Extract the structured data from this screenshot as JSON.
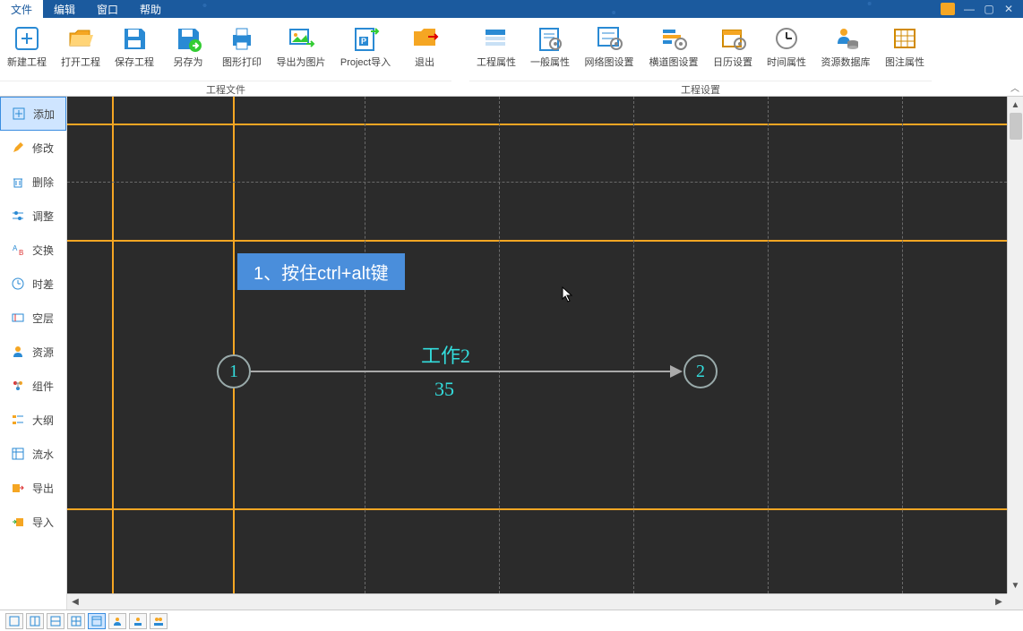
{
  "menu": {
    "file": "文件",
    "edit": "编辑",
    "window": "窗口",
    "help": "帮助"
  },
  "ribbon": {
    "group_file": "工程文件",
    "group_settings": "工程设置",
    "new_project": "新建工程",
    "open_project": "打开工程",
    "save_project": "保存工程",
    "save_as": "另存为",
    "print": "图形打印",
    "export_image": "导出为图片",
    "project_import": "Project导入",
    "exit": "退出",
    "project_props": "工程属性",
    "general_props": "一般属性",
    "network_settings": "网络图设置",
    "gantt_settings": "横道图设置",
    "calendar_settings": "日历设置",
    "time_props": "时间属性",
    "resource_db": "资源数据库",
    "legend_props": "图注属性"
  },
  "sidebar": {
    "add": "添加",
    "modify": "修改",
    "delete": "删除",
    "adjust": "调整",
    "swap": "交换",
    "time_diff": "时差",
    "blank": "空层",
    "resource": "资源",
    "component": "组件",
    "outline": "大纲",
    "flow": "流水",
    "export": "导出",
    "import": "导入"
  },
  "canvas": {
    "tooltip": "1、按住ctrl+alt键",
    "task_name": "工作2",
    "task_value": "35",
    "node1": "1",
    "node2": "2"
  }
}
